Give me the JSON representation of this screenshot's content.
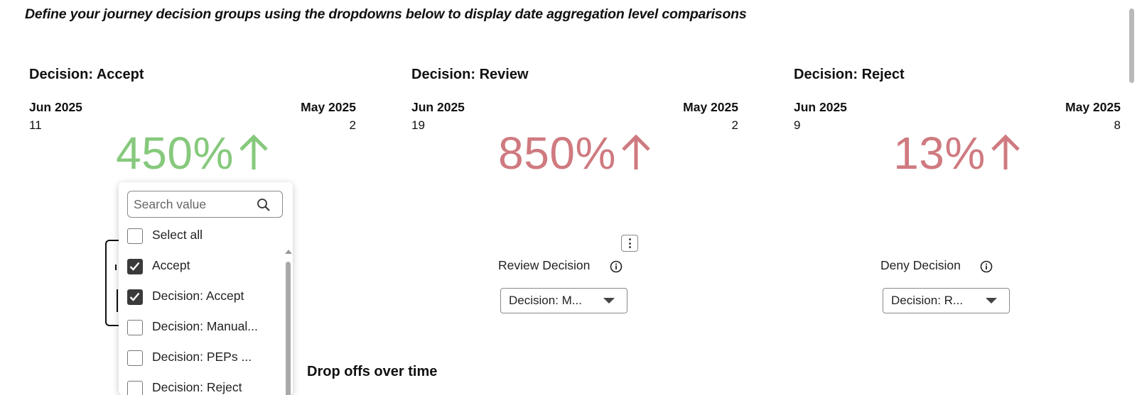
{
  "intro": "Define your journey decision groups using the dropdowns below to display date aggregation level comparisons",
  "cards": [
    {
      "title": "Decision: Accept",
      "current_period": "Jun 2025",
      "previous_period": "May 2025",
      "current_value": "11",
      "previous_value": "2",
      "change": "450%",
      "change_color": "#86c97c",
      "direction": "up-arrow-icon"
    },
    {
      "title": "Decision: Review",
      "current_period": "Jun 2025",
      "previous_period": "May 2025",
      "current_value": "19",
      "previous_value": "2",
      "change": "850%",
      "change_color": "#cf7a80",
      "direction": "up-arrow-icon"
    },
    {
      "title": "Decision: Reject",
      "current_period": "Jun 2025",
      "previous_period": "May 2025",
      "current_value": "9",
      "previous_value": "8",
      "change": "13%",
      "change_color": "#cf7a80",
      "direction": "up-arrow-icon"
    }
  ],
  "filters": [
    {
      "label": "Review Decision",
      "selected": "Decision: M..."
    },
    {
      "label": "Deny Decision",
      "selected": "Decision: R..."
    }
  ],
  "dropdown": {
    "search_placeholder": "Search value",
    "options": [
      {
        "label": "Select all",
        "checked": false
      },
      {
        "label": "Accept",
        "checked": true
      },
      {
        "label": "Decision: Accept",
        "checked": true
      },
      {
        "label": "Decision: Manual...",
        "checked": false
      },
      {
        "label": "Decision: PEPs ...",
        "checked": false
      },
      {
        "label": "Decision: Reject",
        "checked": false
      }
    ]
  },
  "section_title": "Drop offs over time",
  "colors": {
    "positive": "#86c97c",
    "negative": "#cf7a80",
    "text": "#111111"
  }
}
